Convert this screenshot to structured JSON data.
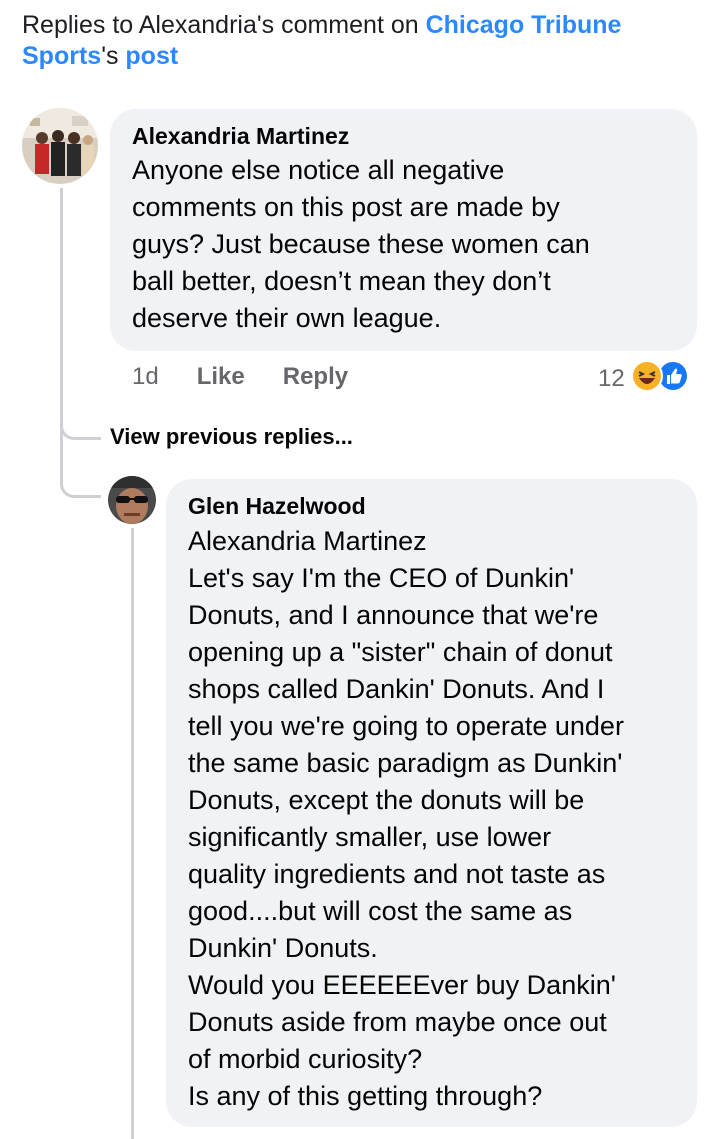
{
  "header": {
    "prefix": "Replies to Alexandria's comment on ",
    "page_link": "Chicago Tribune Sports",
    "possessive": "'s ",
    "post_link": "post"
  },
  "comment": {
    "author": "Alexandria Martinez",
    "text": "Anyone else notice all negative\ncomments on this post are made by\nguys? Just because these women can\nball better, doesn’t mean they don’t\ndeserve their own league.",
    "time": "1d",
    "like_label": "Like",
    "reply_label": "Reply",
    "reaction_count": "12",
    "reaction_icons": [
      "haha-icon",
      "like-reaction-icon"
    ]
  },
  "view_previous": "View previous replies...",
  "reply": {
    "author": "Glen Hazelwood",
    "mention": "Alexandria Martinez",
    "text": "Let's say I'm the CEO of Dunkin'\nDonuts, and I announce that we're\nopening up a \"sister\" chain of donut\nshops called Dankin' Donuts. And I\ntell you we're going to operate under\nthe same basic paradigm as Dunkin'\nDonuts, except the donuts will be\nsignificantly smaller, use lower\nquality ingredients and not taste as\ngood....but will cost the same as\nDunkin' Donuts.\nWould you EEEEEEver buy Dankin'\nDonuts aside from maybe once out\nof morbid curiosity?\nIs any of this getting through?"
  },
  "colors": {
    "link": "#2d88ff",
    "bubble": "#f0f2f5",
    "muted": "#65676b",
    "like_blue": "#1877f2",
    "haha_yellow": "#f7b125"
  }
}
